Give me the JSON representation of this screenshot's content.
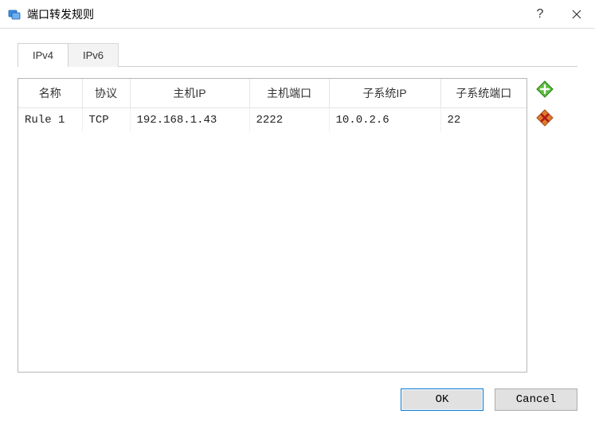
{
  "window": {
    "title": "端口转发规则"
  },
  "tabs": {
    "ipv4": "IPv4",
    "ipv6": "IPv6"
  },
  "table": {
    "headers": {
      "name": "名称",
      "protocol": "协议",
      "host_ip": "主机IP",
      "host_port": "主机端口",
      "guest_ip": "子系统IP",
      "guest_port": "子系统端口"
    },
    "rows": [
      {
        "name": "Rule 1",
        "protocol": "TCP",
        "host_ip": "192.168.1.43",
        "host_port": "2222",
        "guest_ip": "10.0.2.6",
        "guest_port": "22"
      }
    ]
  },
  "buttons": {
    "ok": "OK",
    "cancel": "Cancel"
  }
}
